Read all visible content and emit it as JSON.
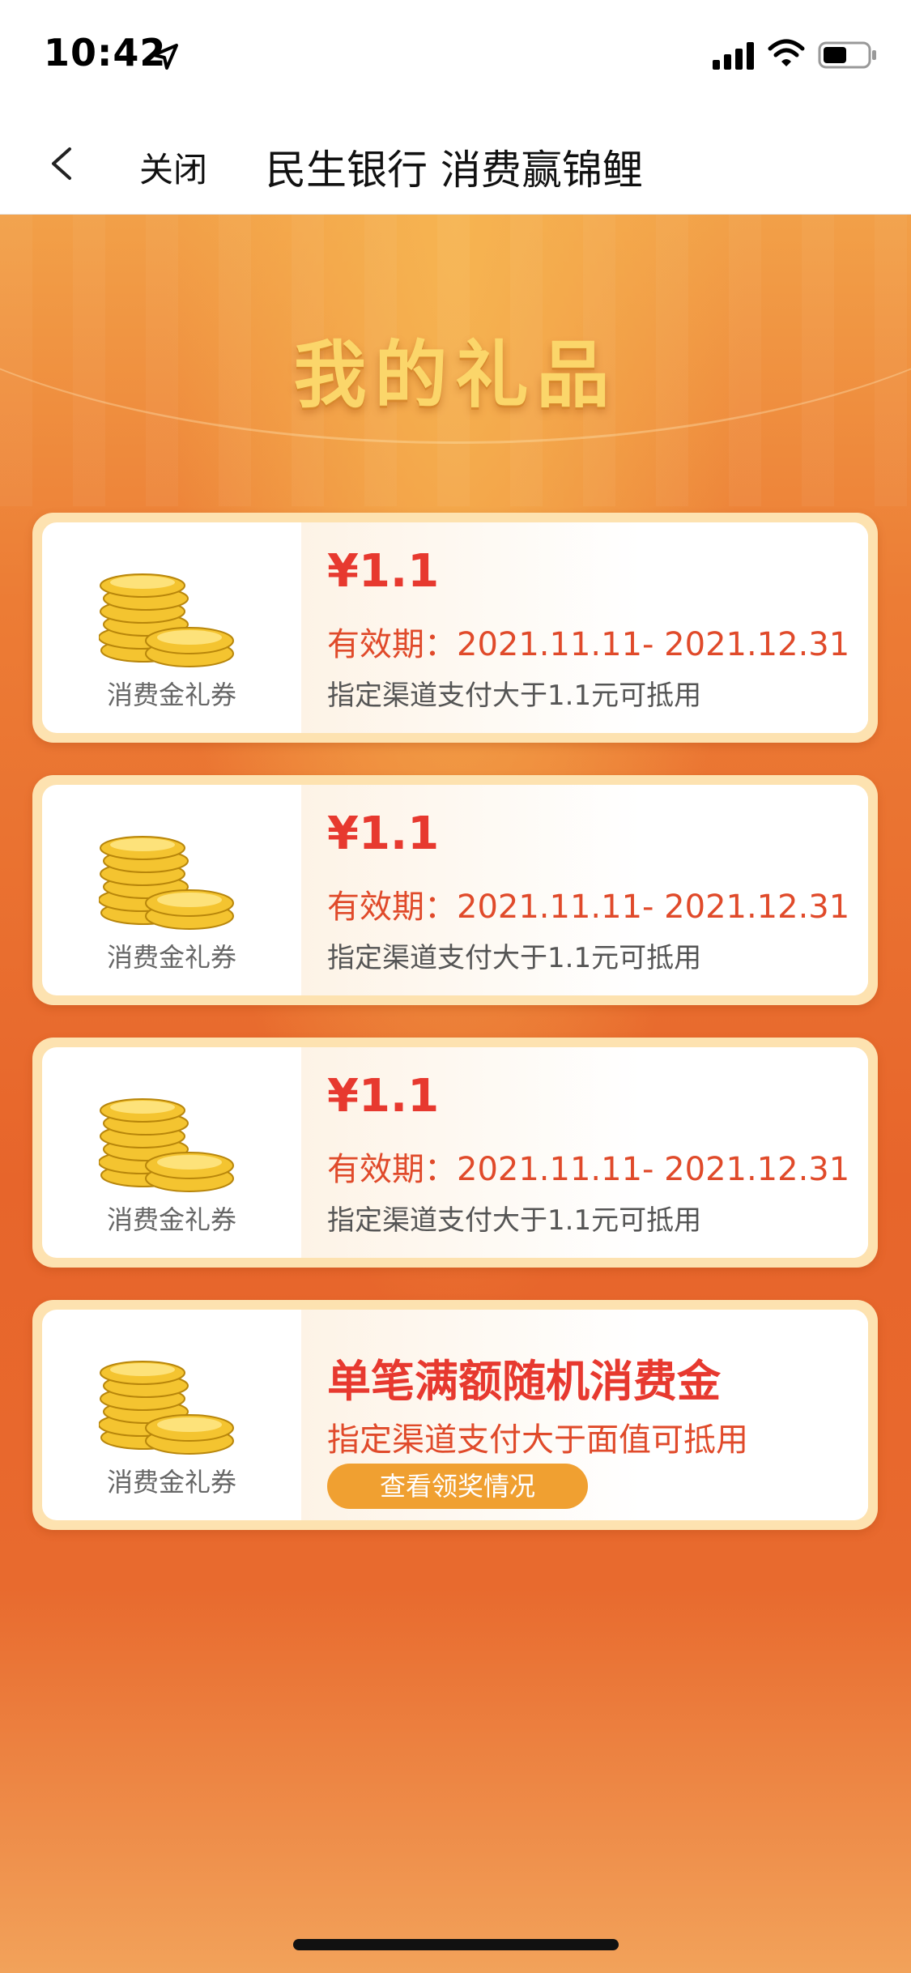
{
  "status_bar": {
    "time": "10:42"
  },
  "nav": {
    "close_label": "关闭",
    "title": "民生银行 消费赢锦鲤"
  },
  "page": {
    "heading": "我的礼品"
  },
  "cards": [
    {
      "coin_label": "消费金礼券",
      "amount": "¥1.1",
      "validity": "有效期：2021.11.11- 2021.12.31",
      "condition": "指定渠道支付大于1.1元可抵用"
    },
    {
      "coin_label": "消费金礼券",
      "amount": "¥1.1",
      "validity": "有效期：2021.11.11- 2021.12.31",
      "condition": "指定渠道支付大于1.1元可抵用"
    },
    {
      "coin_label": "消费金礼券",
      "amount": "¥1.1",
      "validity": "有效期：2021.11.11- 2021.12.31",
      "condition": "指定渠道支付大于1.1元可抵用"
    }
  ],
  "promo_card": {
    "coin_label": "消费金礼券",
    "title": "单笔满额随机消费金",
    "subtitle": "指定渠道支付大于面值可抵用",
    "button_label": "查看领奖情况"
  },
  "colors": {
    "accent_red": "#e7392f",
    "button_orange": "#f0a031",
    "heading_gold": "#fbd66a"
  }
}
